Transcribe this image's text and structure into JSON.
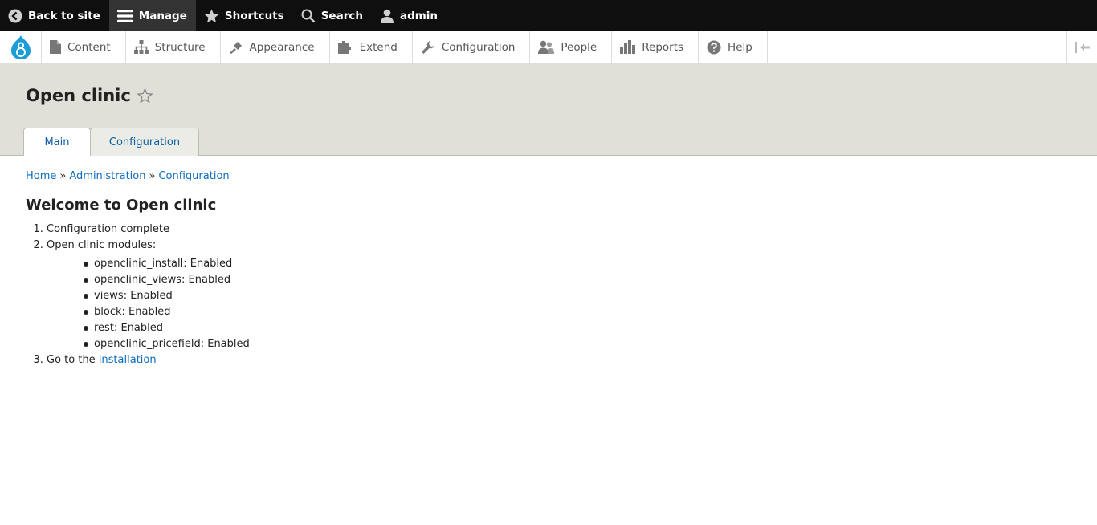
{
  "toolbar": {
    "back_label": "Back to site",
    "manage_label": "Manage",
    "shortcuts_label": "Shortcuts",
    "search_label": "Search",
    "user_label": "admin"
  },
  "tray": {
    "items": [
      {
        "label": "Content",
        "icon": "file-icon"
      },
      {
        "label": "Structure",
        "icon": "sitemap-icon"
      },
      {
        "label": "Appearance",
        "icon": "paintbrush-icon"
      },
      {
        "label": "Extend",
        "icon": "puzzle-icon"
      },
      {
        "label": "Configuration",
        "icon": "wrench-icon"
      },
      {
        "label": "People",
        "icon": "people-icon"
      },
      {
        "label": "Reports",
        "icon": "bar-chart-icon"
      },
      {
        "label": "Help",
        "icon": "help-icon"
      }
    ]
  },
  "header": {
    "title": "Open clinic",
    "tabs": [
      {
        "label": "Main",
        "active": true
      },
      {
        "label": "Configuration",
        "active": false
      }
    ]
  },
  "breadcrumb": {
    "home": "Home",
    "separator": "»",
    "admin": "Administration",
    "config": "Configuration"
  },
  "main": {
    "heading": "Welcome to Open clinic",
    "step1": "Configuration complete",
    "step2": "Open clinic modules:",
    "modules": [
      "openclinic_install: Enabled",
      "openclinic_views: Enabled",
      "views: Enabled",
      "block: Enabled",
      "rest: Enabled",
      "openclinic_pricefield: Enabled"
    ],
    "step3_prefix": "Go to the ",
    "step3_link": "installation"
  },
  "colors": {
    "link": "#0d6cbf",
    "header_bg": "#e0e0d8",
    "toolbar_bg": "#0f0f0f",
    "drupal_blue": "#1d9cd8"
  }
}
